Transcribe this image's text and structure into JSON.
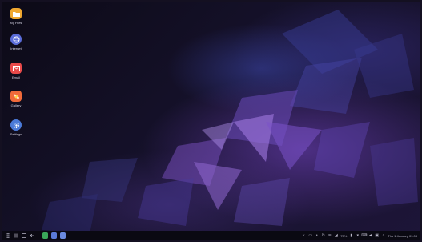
{
  "desktop": {
    "icons": [
      {
        "label": "My Files",
        "icon": "folder-icon",
        "color": "#f0a830"
      },
      {
        "label": "Internet",
        "icon": "internet-icon",
        "color": "#5a6cd8"
      },
      {
        "label": "Email",
        "icon": "email-icon",
        "color": "#e84a4a"
      },
      {
        "label": "Gallery",
        "icon": "gallery-icon",
        "color": "#f06a3a"
      },
      {
        "label": "Settings",
        "icon": "settings-icon",
        "color": "#4a7ad8"
      }
    ]
  },
  "taskbar": {
    "left_buttons": [
      "apps-icon",
      "recent-apps-icon",
      "home-icon",
      "back-icon"
    ],
    "running_apps": [
      {
        "icon": "phone-app-icon",
        "color": "#3aa85a"
      },
      {
        "icon": "internet-app-icon",
        "color": "#5a7ad8"
      },
      {
        "icon": "contacts-app-icon",
        "color": "#6a8ae0"
      }
    ],
    "tray": {
      "battery": "75%",
      "clock": "Thu 1 January  09:08"
    }
  }
}
